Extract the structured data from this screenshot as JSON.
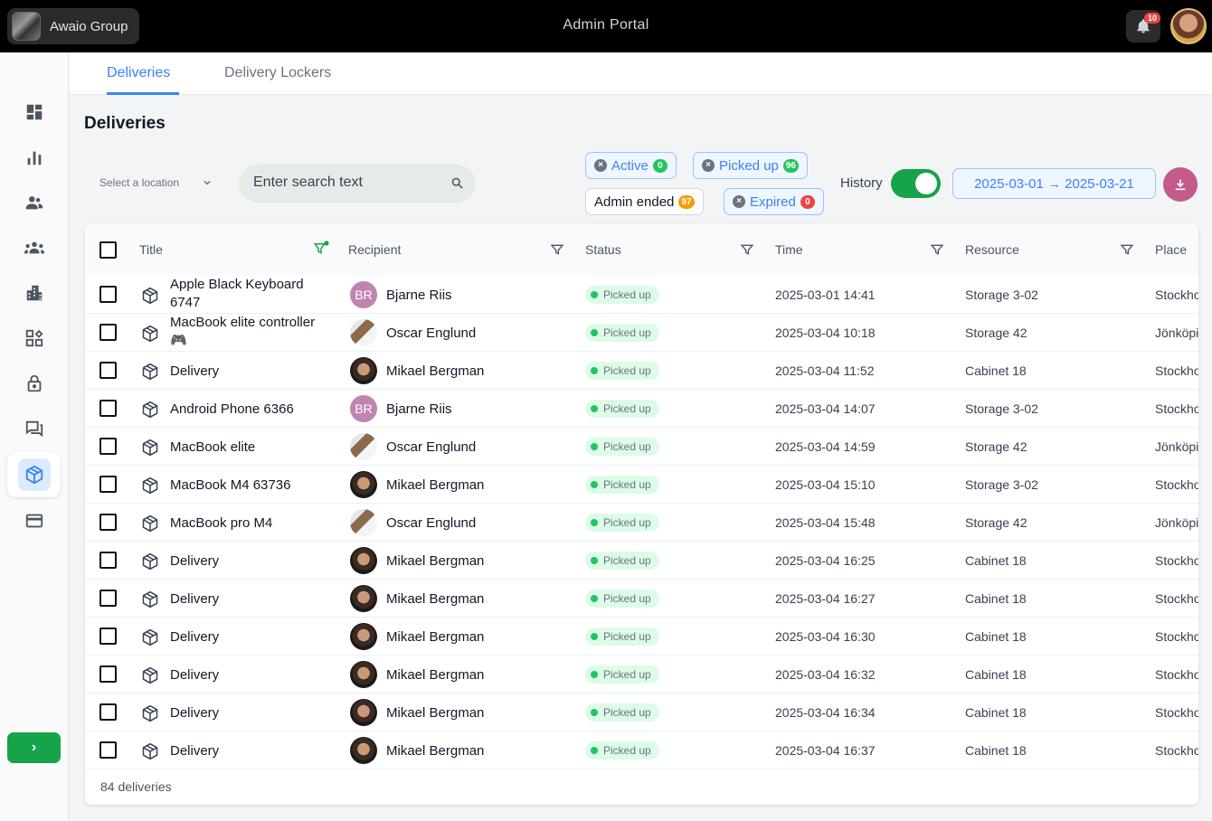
{
  "header": {
    "org_name": "Awaio Group",
    "portal_title": "Admin Portal",
    "notification_count": "10"
  },
  "sidebar": {
    "items": [
      {
        "icon": "dashboard-icon"
      },
      {
        "icon": "bar-chart-icon"
      },
      {
        "icon": "users-icon"
      },
      {
        "icon": "groups-icon"
      },
      {
        "icon": "buildings-icon"
      },
      {
        "icon": "apps-icon"
      },
      {
        "icon": "lock-icon"
      },
      {
        "icon": "chat-icon"
      },
      {
        "icon": "package-icon",
        "active": true
      },
      {
        "icon": "card-icon"
      }
    ],
    "expand_label": "›"
  },
  "tabs": [
    {
      "label": "Deliveries",
      "active": true
    },
    {
      "label": "Delivery Lockers",
      "active": false
    }
  ],
  "page_title": "Deliveries",
  "filters": {
    "location_placeholder": "Select a location",
    "search_placeholder": "Enter search text",
    "chips": [
      {
        "label": "Active",
        "count": "0",
        "count_color": "#22c55e",
        "removable": true
      },
      {
        "label": "Picked up",
        "count": "96",
        "count_color": "#22c55e",
        "removable": true
      },
      {
        "label": "Admin ended",
        "count": "97",
        "count_color": "#f59e0b",
        "removable": false
      },
      {
        "label": "Expired",
        "count": "0",
        "count_color": "#ef4444",
        "removable": true
      }
    ],
    "history_label": "History",
    "history_on": true,
    "date_range": "2025-03-01 → 2025-03-21"
  },
  "table": {
    "columns": [
      "Title",
      "Recipient",
      "Status",
      "Time",
      "Resource",
      "Place"
    ],
    "rows": [
      {
        "title": "Apple Black Keyboard 6747",
        "recipient": "Bjarne Riis",
        "avatar": "BR",
        "status": "Picked up",
        "time": "2025-03-01 14:41",
        "resource": "Storage 3-02",
        "place": "Stockholm"
      },
      {
        "title": "MacBook elite controller 🎮",
        "recipient": "Oscar Englund",
        "avatar": "ph2",
        "status": "Picked up",
        "time": "2025-03-04 10:18",
        "resource": "Storage 42",
        "place": "Jönköping"
      },
      {
        "title": "Delivery",
        "recipient": "Mikael Bergman",
        "avatar": "ph1",
        "status": "Picked up",
        "time": "2025-03-04 11:52",
        "resource": "Cabinet 18",
        "place": "Stockholm"
      },
      {
        "title": "Android Phone 6366",
        "recipient": "Bjarne Riis",
        "avatar": "BR",
        "status": "Picked up",
        "time": "2025-03-04 14:07",
        "resource": "Storage 3-02",
        "place": "Stockholm"
      },
      {
        "title": "MacBook elite",
        "recipient": "Oscar Englund",
        "avatar": "ph2",
        "status": "Picked up",
        "time": "2025-03-04 14:59",
        "resource": "Storage 42",
        "place": "Jönköping"
      },
      {
        "title": "MacBook M4 63736",
        "recipient": "Mikael Bergman",
        "avatar": "ph1",
        "status": "Picked up",
        "time": "2025-03-04 15:10",
        "resource": "Storage 3-02",
        "place": "Stockholm"
      },
      {
        "title": "MacBook pro M4",
        "recipient": "Oscar Englund",
        "avatar": "ph2",
        "status": "Picked up",
        "time": "2025-03-04 15:48",
        "resource": "Storage 42",
        "place": "Jönköping"
      },
      {
        "title": "Delivery",
        "recipient": "Mikael Bergman",
        "avatar": "ph1",
        "status": "Picked up",
        "time": "2025-03-04 16:25",
        "resource": "Cabinet 18",
        "place": "Stockholm"
      },
      {
        "title": "Delivery",
        "recipient": "Mikael Bergman",
        "avatar": "ph1",
        "status": "Picked up",
        "time": "2025-03-04 16:27",
        "resource": "Cabinet 18",
        "place": "Stockholm"
      },
      {
        "title": "Delivery",
        "recipient": "Mikael Bergman",
        "avatar": "ph1",
        "status": "Picked up",
        "time": "2025-03-04 16:30",
        "resource": "Cabinet 18",
        "place": "Stockholm"
      },
      {
        "title": "Delivery",
        "recipient": "Mikael Bergman",
        "avatar": "ph1",
        "status": "Picked up",
        "time": "2025-03-04 16:32",
        "resource": "Cabinet 18",
        "place": "Stockholm"
      },
      {
        "title": "Delivery",
        "recipient": "Mikael Bergman",
        "avatar": "ph1",
        "status": "Picked up",
        "time": "2025-03-04 16:34",
        "resource": "Cabinet 18",
        "place": "Stockholm"
      },
      {
        "title": "Delivery",
        "recipient": "Mikael Bergman",
        "avatar": "ph1",
        "status": "Picked up",
        "time": "2025-03-04 16:37",
        "resource": "Cabinet 18",
        "place": "Stockholm"
      }
    ],
    "footer": "84 deliveries"
  },
  "colors": {
    "accent": "#3b82f6",
    "success": "#16a34a",
    "download": "#c45a8a"
  }
}
